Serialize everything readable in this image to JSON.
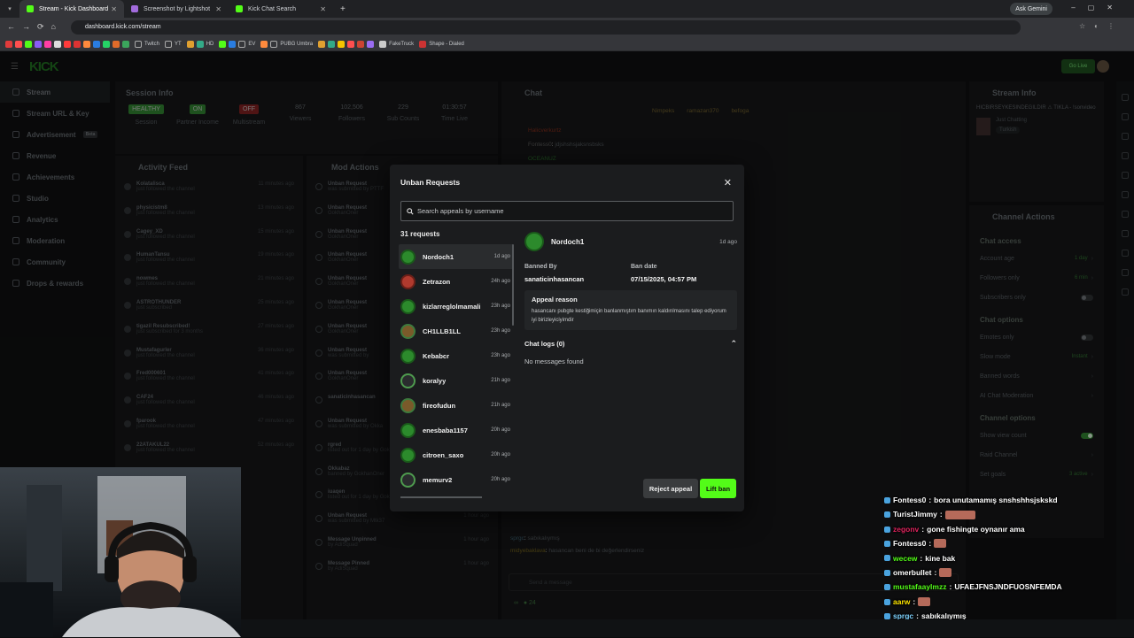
{
  "browser": {
    "tabs": [
      {
        "title": "Stream - Kick Dashboard",
        "color": "#53fc18",
        "active": true
      },
      {
        "title": "Screenshot by Lightshot",
        "color": "#a26bdc",
        "active": false
      },
      {
        "title": "Kick Chat Search",
        "color": "#53fc18",
        "active": false
      }
    ],
    "new_tab": "+",
    "ask_gemini": "Ask Gemini",
    "url": "dashboard.kick.com/stream",
    "bookmarks": [
      "Twitch",
      "YT",
      "HD",
      "EV",
      "PUBG Umbra",
      "FakeTruck",
      "Shape - Dialed"
    ]
  },
  "app": {
    "logo": "KICK",
    "go_live": "Go Live",
    "sidebar": [
      {
        "label": "Stream",
        "active": true
      },
      {
        "label": "Stream URL & Key"
      },
      {
        "label": "Advertisement",
        "badge": "Beta"
      },
      {
        "label": "Revenue"
      },
      {
        "label": "Achievements"
      },
      {
        "label": "Studio"
      },
      {
        "label": "Analytics"
      },
      {
        "label": "Moderation"
      },
      {
        "label": "Community"
      },
      {
        "label": "Drops & rewards"
      }
    ],
    "session": {
      "title": "Session Info",
      "stats": [
        {
          "value": "HEALTHY",
          "label": "Session",
          "badge": true,
          "color": "#2f7d2f"
        },
        {
          "value": "ON",
          "label": "Partner Income",
          "badge": true,
          "color": "#2f7d2f"
        },
        {
          "value": "OFF",
          "label": "Multistream",
          "badge": true,
          "color": "#7a2020"
        },
        {
          "value": "867",
          "label": "Viewers"
        },
        {
          "value": "102,506",
          "label": "Followers"
        },
        {
          "value": "229",
          "label": "Sub Counts"
        },
        {
          "value": "01:30:57",
          "label": "Time Live"
        }
      ]
    },
    "activity_feed": {
      "title": "Activity Feed",
      "items": [
        {
          "name": "Kolatalisca",
          "sub": "just followed the channel",
          "time": "11 minutes ago"
        },
        {
          "name": "physicistm8",
          "sub": "just followed the channel",
          "time": "13 minutes ago"
        },
        {
          "name": "Cagey_XD",
          "sub": "just followed the channel",
          "time": "15 minutes ago"
        },
        {
          "name": "HumanTansu",
          "sub": "just followed the channel",
          "time": "19 minutes ago"
        },
        {
          "name": "nowmes",
          "sub": "just followed the channel",
          "time": "21 minutes ago"
        },
        {
          "name": "ASTROTHUNDER",
          "sub": "just subscribed",
          "time": "25 minutes ago"
        },
        {
          "name": "tigazil Resubscribed!",
          "sub": "just subscribed for 3 months",
          "time": "27 minutes ago"
        },
        {
          "name": "Mustafagurler",
          "sub": "just followed the channel",
          "time": "36 minutes ago"
        },
        {
          "name": "Fred000601",
          "sub": "just followed the channel",
          "time": "41 minutes ago"
        },
        {
          "name": "CAF24",
          "sub": "just followed the channel",
          "time": "46 minutes ago"
        },
        {
          "name": "fparook",
          "sub": "just followed the channel",
          "time": "47 minutes ago"
        },
        {
          "name": "22ATAKUL22",
          "sub": "just followed the channel",
          "time": "52 minutes ago"
        }
      ]
    },
    "mod_actions": {
      "title": "Mod Actions",
      "items": [
        {
          "name": "Unban Request",
          "sub": "was submitted by PTTF",
          "time": ""
        },
        {
          "name": "Unban Request",
          "sub": "GokhanOner",
          "time": ""
        },
        {
          "name": "Unban Request",
          "sub": "GokhanOner",
          "time": ""
        },
        {
          "name": "Unban Request",
          "sub": "GokhanOner",
          "time": ""
        },
        {
          "name": "Unban Request",
          "sub": "GokhanOner",
          "time": ""
        },
        {
          "name": "Unban Request",
          "sub": "GokhanOner",
          "time": ""
        },
        {
          "name": "Unban Request",
          "sub": "GokhanOner",
          "time": ""
        },
        {
          "name": "Unban Request",
          "sub": "was submitted by",
          "time": ""
        },
        {
          "name": "Unban Request",
          "sub": "GokhanOner",
          "time": ""
        },
        {
          "name": "sanaticinhasancan",
          "sub": "",
          "time": ""
        },
        {
          "name": "Unban Request",
          "sub": "was submitted by Okka",
          "time": ""
        },
        {
          "name": "rgred",
          "sub": "listed out for 1 day by GokhanOner",
          "time": "1 hour ago"
        },
        {
          "name": "Okkabaz",
          "sub": "banned by GokhanOner",
          "time": "1 hour ago"
        },
        {
          "name": "iuaqen",
          "sub": "listed out for 1 day by GokhanOner",
          "time": "1 hour ago"
        },
        {
          "name": "Unban Request",
          "sub": "was submitted by Mtk37",
          "time": "1 hour ago"
        },
        {
          "name": "Message Unpinned",
          "sub": "by AdiSquad",
          "time": "1 hour ago"
        },
        {
          "name": "Message Pinned",
          "sub": "by AdiSquad",
          "time": "1 hour ago"
        }
      ]
    },
    "chat": {
      "title": "Chat",
      "top_users": [
        "Nimpeks",
        "ramazan370",
        "befoga"
      ],
      "lines": [
        {
          "user": "Halicverkurtz",
          "text": ""
        },
        {
          "user": "Fontess0",
          "text": "jdjshshsjaksnsbsks"
        },
        {
          "user": "OCEANUZ",
          "text": ""
        },
        {
          "user": "sprgc",
          "text": "sabıkalıymış"
        },
        {
          "user": "midyebaklava",
          "text": "hasancan beni de bi değerlendirseniz"
        }
      ],
      "placeholder": "Send a message",
      "viewer_count": "24"
    },
    "stream_info": {
      "title": "Stream Info",
      "stream_title": "HICBIRSEYKESINDEGILDIR ⚠ TIKLA - !sonvideo",
      "category": "Just Chatting",
      "tag": "Turkish"
    },
    "channel_actions": {
      "title": "Channel Actions",
      "sections": [
        {
          "heading": "Chat access",
          "rows": [
            {
              "label": "Account age",
              "value": "1 day"
            },
            {
              "label": "Followers only",
              "value": "6 min"
            },
            {
              "label": "Subscribers only",
              "toggle": false
            }
          ]
        },
        {
          "heading": "Chat options",
          "rows": [
            {
              "label": "Emotes only",
              "toggle": false
            },
            {
              "label": "Slow mode",
              "value": "Instant"
            },
            {
              "label": "Banned words",
              "value": ""
            },
            {
              "label": "AI Chat Moderation",
              "value": ""
            }
          ]
        },
        {
          "heading": "Channel options",
          "rows": [
            {
              "label": "Show view count",
              "toggle": true
            },
            {
              "label": "Raid Channel",
              "value": ""
            },
            {
              "label": "Set goals",
              "value": "3 active"
            }
          ]
        }
      ]
    }
  },
  "modal": {
    "title": "Unban Requests",
    "search_placeholder": "Search appeals by username",
    "count_label": "31 requests",
    "requests": [
      {
        "username": "Nordoch1",
        "ago": "1d ago",
        "selected": true,
        "avatar": "green"
      },
      {
        "username": "Zetrazon",
        "ago": "24h ago",
        "avatar": "red"
      },
      {
        "username": "kizlarreglolmamali",
        "ago": "23h ago",
        "avatar": "green"
      },
      {
        "username": "CH1LLB1LL",
        "ago": "23h ago",
        "avatar": "brown"
      },
      {
        "username": "Kebabcr",
        "ago": "23h ago",
        "avatar": "green"
      },
      {
        "username": "koralyy",
        "ago": "21h ago",
        "avatar": "dark"
      },
      {
        "username": "fireofudun",
        "ago": "21h ago",
        "avatar": "brown"
      },
      {
        "username": "enesbaba1157",
        "ago": "20h ago",
        "avatar": "green"
      },
      {
        "username": "citroen_saxo",
        "ago": "20h ago",
        "avatar": "green"
      },
      {
        "username": "memurv2",
        "ago": "20h ago",
        "avatar": "dark"
      }
    ],
    "detail": {
      "username": "Nordoch1",
      "ago": "1d ago",
      "banned_by_label": "Banned By",
      "banned_by": "sanaticinhasancan",
      "ban_date_label": "Ban date",
      "ban_date": "07/15/2025, 04:57 PM",
      "appeal_label": "Appeal reason",
      "appeal_text": "hasancanı pubgte kestiğimiçin banlanmıştım banımın kaldırılmasını talep ediyorum iyi birizleyiciyimdir",
      "chat_logs_label": "Chat logs (0)",
      "no_messages": "No messages found"
    },
    "reject_label": "Reject appeal",
    "lift_label": "Lift ban",
    "accent": "#53fc18"
  },
  "overlay_chat": [
    {
      "user": "Fontess0",
      "text": "bora unutamamış snshshhsjskskd",
      "color": "#ffffff",
      "emote": false
    },
    {
      "user": "TuristJimmy",
      "text": "",
      "color": "#ffffff",
      "emote": true
    },
    {
      "user": "zegonv",
      "text": "gone fishingte oynanır ama",
      "color": "#e0245e",
      "emote": false
    },
    {
      "user": "Fontess0",
      "text": "",
      "color": "#ffffff",
      "emote": true
    },
    {
      "user": "wecew",
      "text": "kine bak",
      "color": "#53fc18",
      "emote": false
    },
    {
      "user": "omerbullet",
      "text": "",
      "color": "#ffffff",
      "emote": true
    },
    {
      "user": "mustafaaylmzz",
      "text": "UFAEJFNSJNDFUOSNFEMDA",
      "color": "#53fc18",
      "emote": false
    },
    {
      "user": "aarw",
      "text": "",
      "color": "#ffe600",
      "emote": true
    },
    {
      "user": "sprgc",
      "text": "sabıkalıymış",
      "color": "#7fd3ff",
      "emote": false
    },
    {
      "user": "midyebaklava",
      "text": "hasancan beni de bi değerlendirseniz",
      "color": "#ffe600",
      "emote": false
    }
  ]
}
